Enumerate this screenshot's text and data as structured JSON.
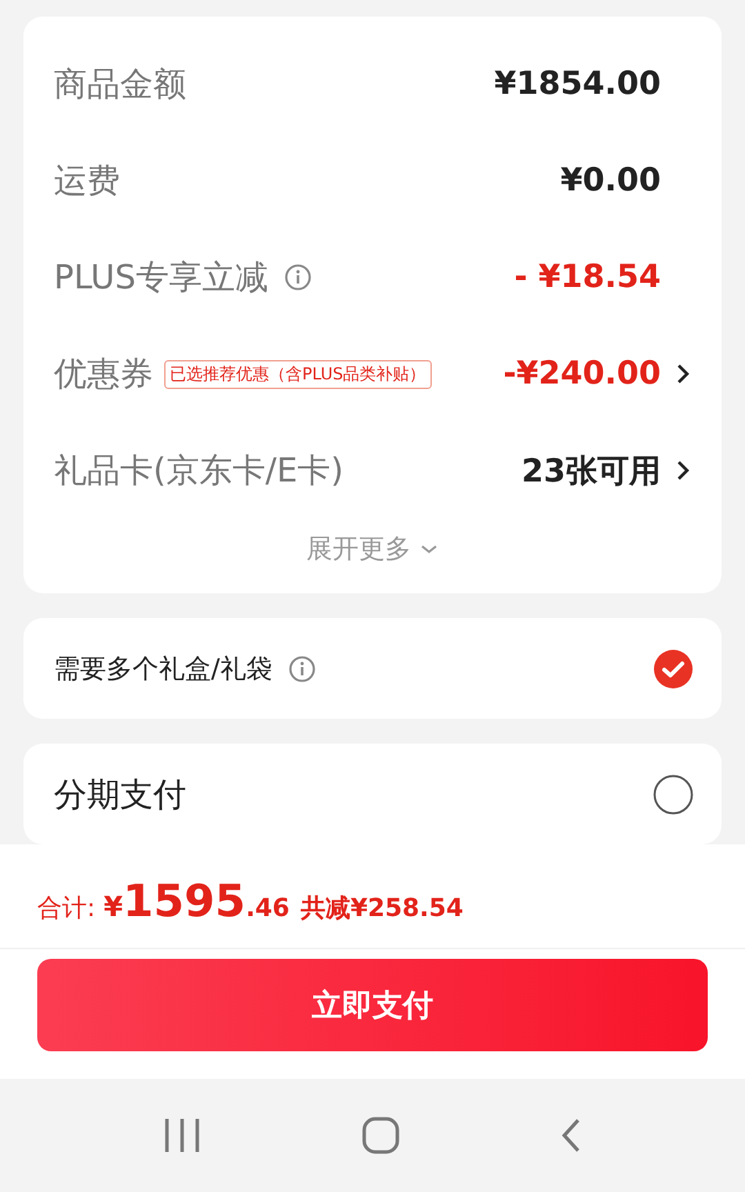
{
  "summary": {
    "rows": [
      {
        "label": "商品金额",
        "kind": "charge",
        "value": "¥1854.00",
        "info": false,
        "chevron": false
      },
      {
        "label": "运费",
        "kind": "charge",
        "value": "¥0.00",
        "info": false,
        "chevron": false
      },
      {
        "label": "PLUS专享立减",
        "kind": "discount",
        "value": "- ¥18.54",
        "info": true,
        "chevron": false
      },
      {
        "label": "优惠券",
        "kind": "discount",
        "tag": "已选推荐优惠（含PLUS品类补贴）",
        "value": "-¥240.00",
        "info": false,
        "chevron": true
      },
      {
        "label": "礼品卡(京东卡/E卡)",
        "kind": "charge",
        "value": "23张可用",
        "info": false,
        "chevron": true
      }
    ],
    "expand": "展开更多"
  },
  "gift_box": {
    "label": "需要多个礼盒/礼袋",
    "checked": true
  },
  "installment": {
    "label": "分期支付",
    "checked": false
  },
  "footer": {
    "total_label": "合计:",
    "currency": "¥",
    "integer": "1595",
    "decimal": ".46",
    "saving": "共减¥258.54",
    "pay_button": "立即支付"
  }
}
